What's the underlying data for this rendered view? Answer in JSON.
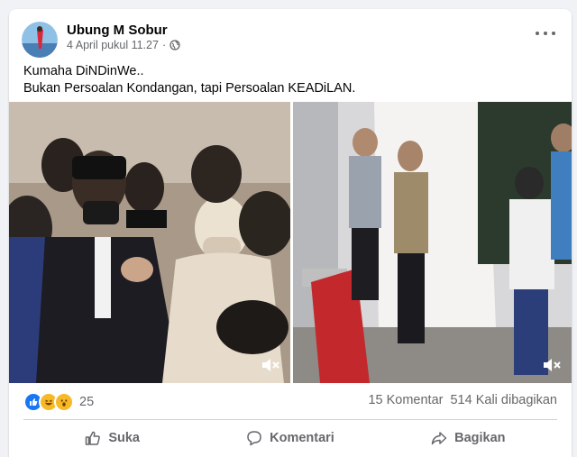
{
  "post": {
    "author": "Ubung M Sobur",
    "date": "4 April pukul 11.27",
    "separator": "·",
    "privacy_icon": "globe-icon",
    "more_icon": "more-options-icon",
    "text_line1": "Kumaha DiNDinWe..",
    "text_line2": "Bukan Persoalan Kondangan, tapi Persoalan KEADiLAN."
  },
  "media": [
    {
      "type": "video",
      "icon": "mute-icon"
    },
    {
      "type": "video",
      "icon": "mute-icon"
    }
  ],
  "reactions": {
    "icons": [
      "like-reaction-icon",
      "haha-reaction-icon",
      "wow-reaction-icon"
    ],
    "count": "25",
    "comments": "15 Komentar",
    "shares": "514 Kali dibagikan"
  },
  "actions": {
    "like": "Suka",
    "comment": "Komentari",
    "share": "Bagikan"
  },
  "colors": {
    "like_blue": "#1877f2",
    "reaction_yellow": "#f7b928",
    "secondary_text": "#65676b"
  }
}
